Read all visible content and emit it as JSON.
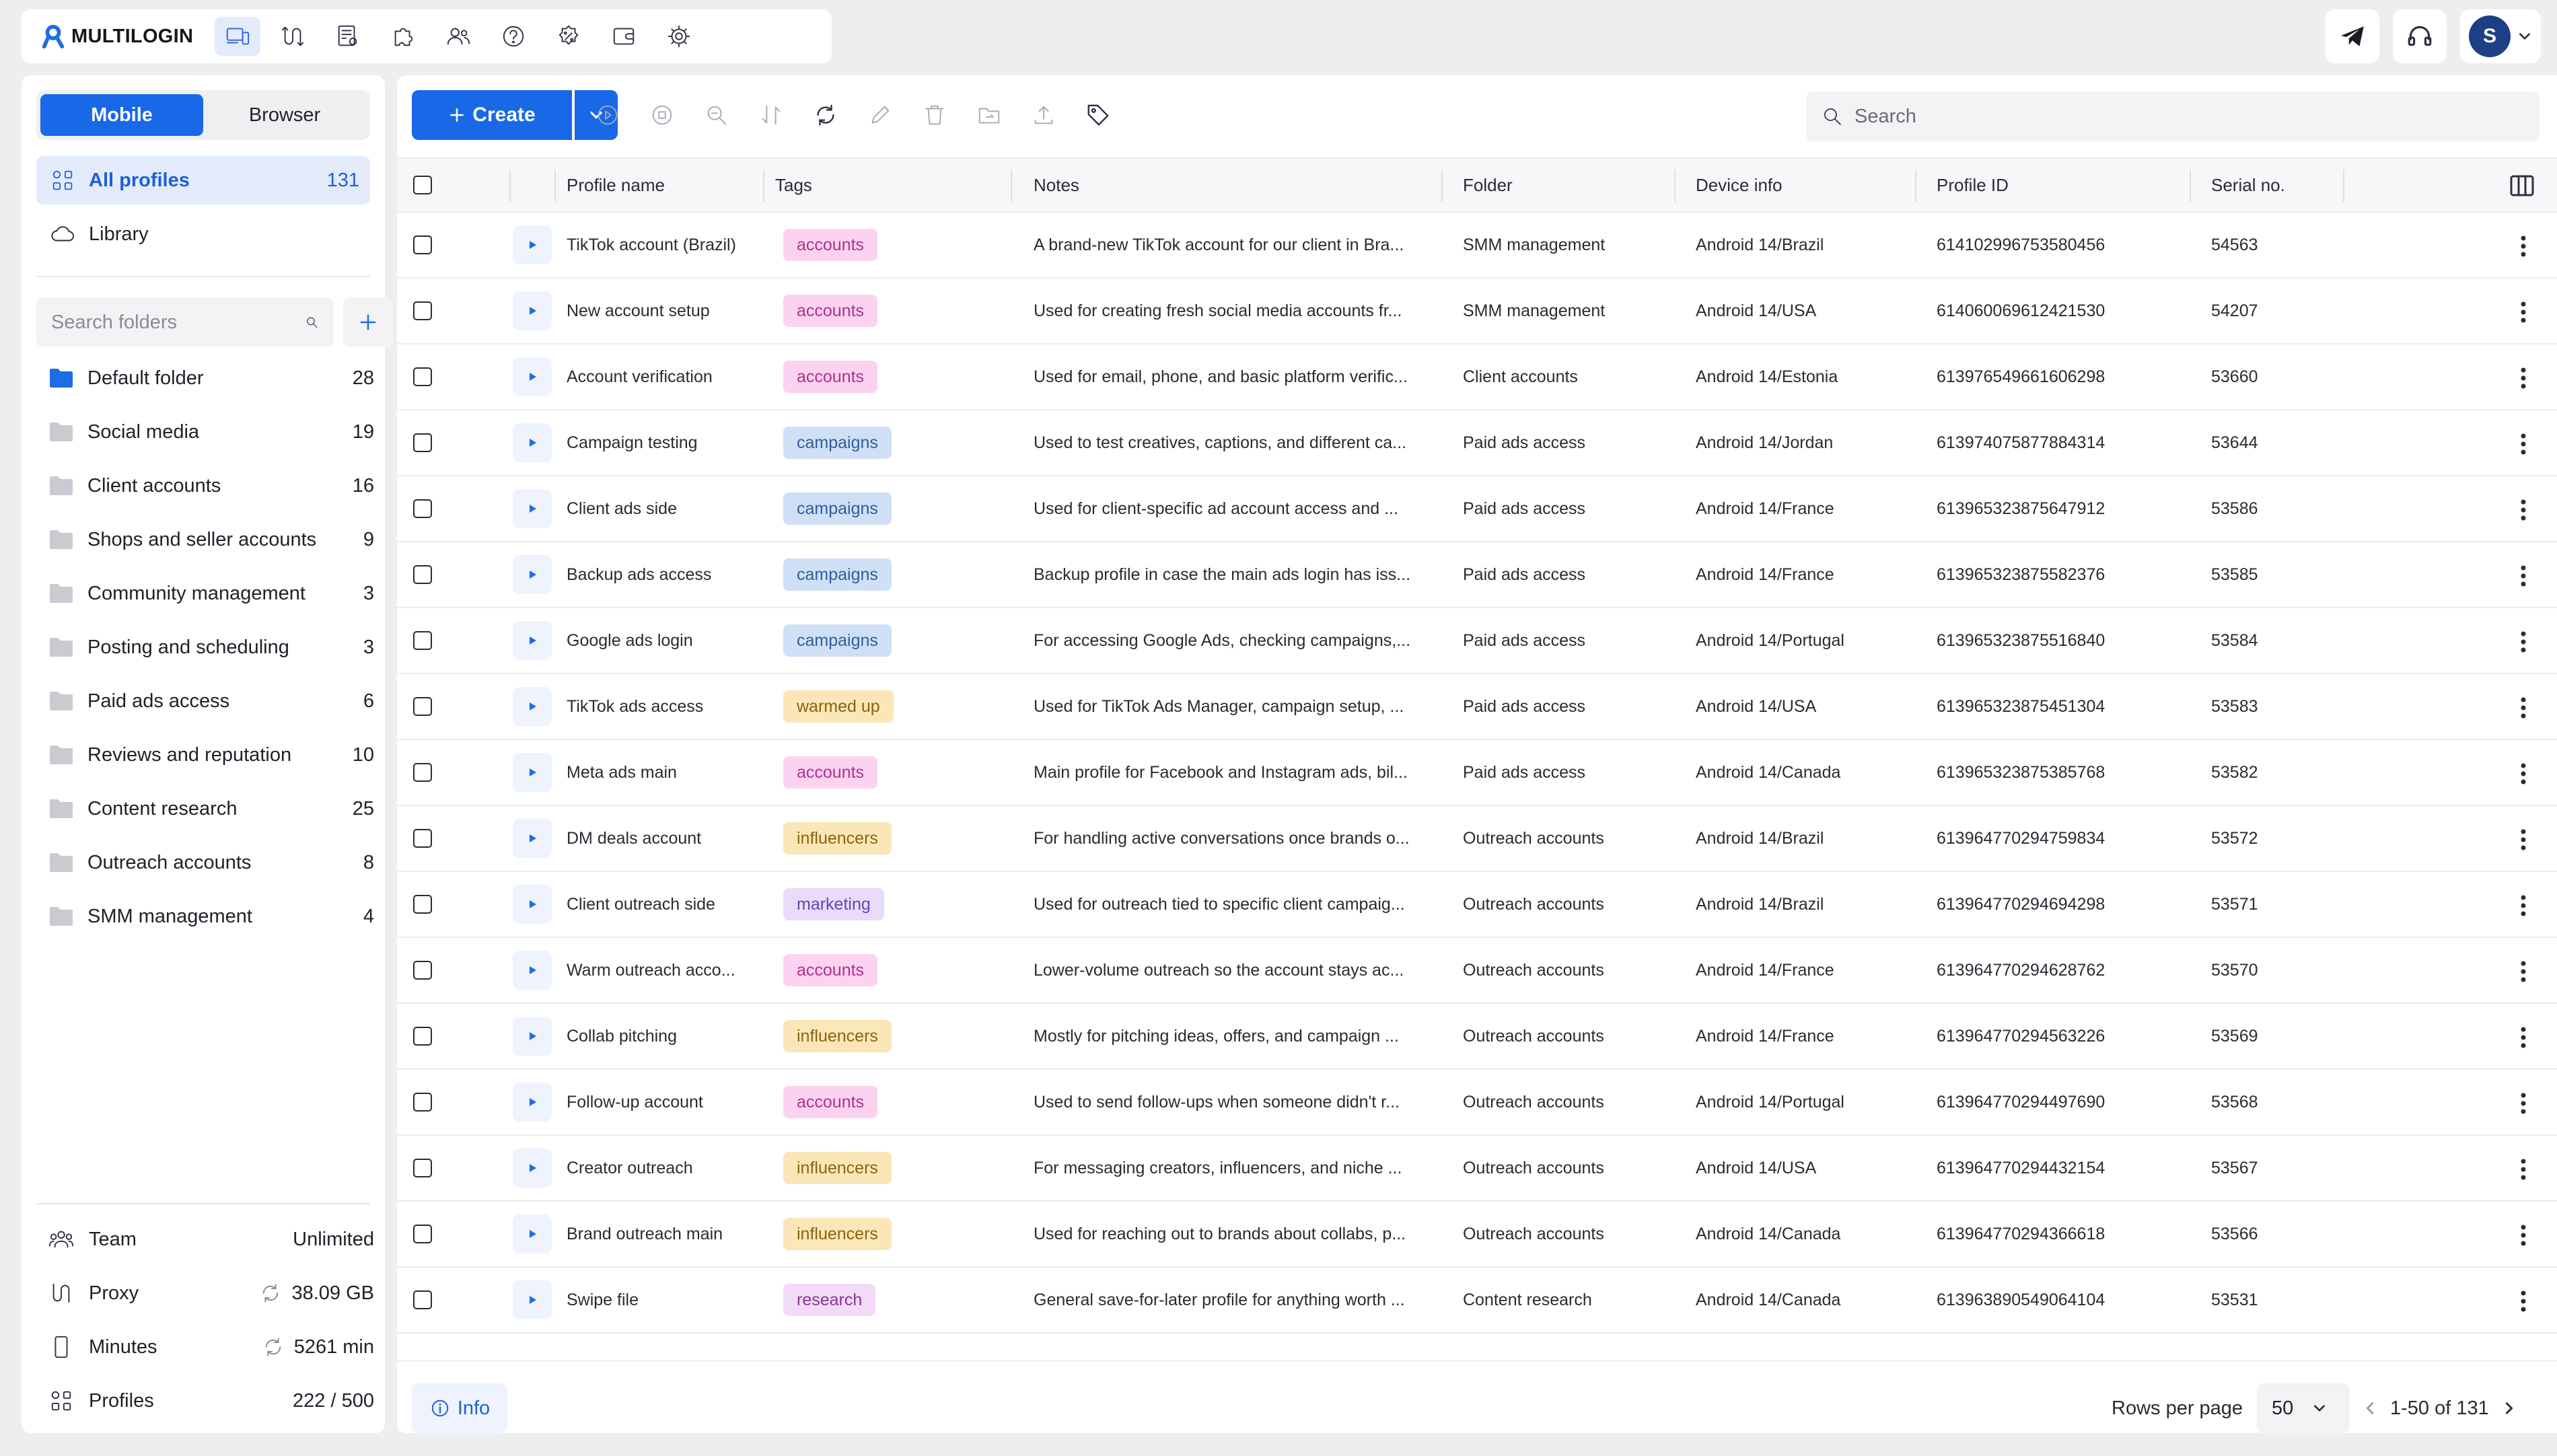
{
  "app": {
    "brand": "MULTILOGIN",
    "avatar_initial": "S"
  },
  "sidebar": {
    "tabs": [
      "Mobile",
      "Browser"
    ],
    "active_tab": "Mobile",
    "all_profiles": {
      "label": "All profiles",
      "count": "131"
    },
    "library": {
      "label": "Library"
    },
    "folder_search_placeholder": "Search folders",
    "folders": [
      {
        "name": "Default folder",
        "count": "28",
        "active": true
      },
      {
        "name": "Social media",
        "count": "19"
      },
      {
        "name": "Client accounts",
        "count": "16"
      },
      {
        "name": "Shops and seller accounts",
        "count": "9"
      },
      {
        "name": "Community management",
        "count": "3"
      },
      {
        "name": "Posting and scheduling",
        "count": "3"
      },
      {
        "name": "Paid ads access",
        "count": "6"
      },
      {
        "name": "Reviews and reputation",
        "count": "10"
      },
      {
        "name": "Content research",
        "count": "25"
      },
      {
        "name": "Outreach accounts",
        "count": "8"
      },
      {
        "name": "SMM management",
        "count": "4"
      }
    ],
    "stats": {
      "team": {
        "label": "Team",
        "value": "Unlimited"
      },
      "proxy": {
        "label": "Proxy",
        "value": "38.09 GB"
      },
      "minutes": {
        "label": "Minutes",
        "value": "5261 min"
      },
      "profiles": {
        "label": "Profiles",
        "value": "222 / 500"
      }
    }
  },
  "toolbar": {
    "create_label": "Create",
    "search_placeholder": "Search"
  },
  "table": {
    "columns": {
      "name": "Profile name",
      "tags": "Tags",
      "notes": "Notes",
      "folder": "Folder",
      "device": "Device info",
      "id": "Profile ID",
      "serial": "Serial no."
    },
    "rows": [
      {
        "name": "TikTok account (Brazil)",
        "tag": "accounts",
        "notes": "A brand-new TikTok account for our client in Bra...",
        "folder": "SMM management",
        "device": "Android 14/Brazil",
        "id": "614102996753580456",
        "serial": "54563"
      },
      {
        "name": "New account setup",
        "tag": "accounts",
        "notes": "Used for creating fresh social media accounts fr...",
        "folder": "SMM management",
        "device": "Android 14/USA",
        "id": "614060069612421530",
        "serial": "54207"
      },
      {
        "name": "Account verification",
        "tag": "accounts",
        "notes": "Used for email, phone, and basic platform verific...",
        "folder": "Client accounts",
        "device": "Android 14/Estonia",
        "id": "613976549661606298",
        "serial": "53660"
      },
      {
        "name": "Campaign testing",
        "tag": "campaigns",
        "notes": "Used to test creatives, captions, and different ca...",
        "folder": "Paid ads access",
        "device": "Android 14/Jordan",
        "id": "613974075877884314",
        "serial": "53644"
      },
      {
        "name": "Client ads side",
        "tag": "campaigns",
        "notes": "Used for client-specific ad account access and ...",
        "folder": "Paid ads access",
        "device": "Android 14/France",
        "id": "613965323875647912",
        "serial": "53586"
      },
      {
        "name": "Backup ads access",
        "tag": "campaigns",
        "notes": "Backup profile in case the main ads login has iss...",
        "folder": "Paid ads access",
        "device": "Android 14/France",
        "id": "613965323875582376",
        "serial": "53585"
      },
      {
        "name": "Google ads login",
        "tag": "campaigns",
        "notes": "For accessing Google Ads, checking campaigns,...",
        "folder": "Paid ads access",
        "device": "Android 14/Portugal",
        "id": "613965323875516840",
        "serial": "53584"
      },
      {
        "name": "TikTok ads access",
        "tag": "warmed up",
        "notes": "Used for TikTok Ads Manager, campaign setup, ...",
        "folder": "Paid ads access",
        "device": "Android 14/USA",
        "id": "613965323875451304",
        "serial": "53583"
      },
      {
        "name": "Meta ads main",
        "tag": "accounts",
        "notes": "Main profile for Facebook and Instagram ads, bil...",
        "folder": "Paid ads access",
        "device": "Android 14/Canada",
        "id": "613965323875385768",
        "serial": "53582"
      },
      {
        "name": "DM deals account",
        "tag": "influencers",
        "notes": "For handling active conversations once brands o...",
        "folder": "Outreach accounts",
        "device": "Android 14/Brazil",
        "id": "613964770294759834",
        "serial": "53572"
      },
      {
        "name": "Client outreach side",
        "tag": "marketing",
        "notes": "Used for outreach tied to specific client campaig...",
        "folder": "Outreach accounts",
        "device": "Android 14/Brazil",
        "id": "613964770294694298",
        "serial": "53571"
      },
      {
        "name": "Warm outreach acco...",
        "tag": "accounts",
        "notes": "Lower-volume outreach so the account stays ac...",
        "folder": "Outreach accounts",
        "device": "Android 14/France",
        "id": "613964770294628762",
        "serial": "53570"
      },
      {
        "name": "Collab pitching",
        "tag": "influencers",
        "notes": "Mostly for pitching ideas, offers, and campaign ...",
        "folder": "Outreach accounts",
        "device": "Android 14/France",
        "id": "613964770294563226",
        "serial": "53569"
      },
      {
        "name": "Follow-up account",
        "tag": "accounts",
        "notes": "Used to send follow-ups when someone didn't r...",
        "folder": "Outreach accounts",
        "device": "Android 14/Portugal",
        "id": "613964770294497690",
        "serial": "53568"
      },
      {
        "name": "Creator outreach",
        "tag": "influencers",
        "notes": "For messaging creators, influencers, and niche ...",
        "folder": "Outreach accounts",
        "device": "Android 14/USA",
        "id": "613964770294432154",
        "serial": "53567"
      },
      {
        "name": "Brand outreach main",
        "tag": "influencers",
        "notes": "Used for reaching out to brands about collabs, p...",
        "folder": "Outreach accounts",
        "device": "Android 14/Canada",
        "id": "613964770294366618",
        "serial": "53566"
      },
      {
        "name": "Swipe file",
        "tag": "research",
        "notes": "General save-for-later profile for anything worth ...",
        "folder": "Content research",
        "device": "Android 14/Canada",
        "id": "613963890549064104",
        "serial": "53531"
      }
    ],
    "tag_colors": {
      "accounts": {
        "bg": "#fbd3f0",
        "fg": "#b0308f"
      },
      "campaigns": {
        "bg": "#cfe0f6",
        "fg": "#2f5e9c"
      },
      "warmed up": {
        "bg": "#fae6b6",
        "fg": "#8a6410"
      },
      "influencers": {
        "bg": "#fae6b6",
        "fg": "#8a6410"
      },
      "marketing": {
        "bg": "#e7dcfa",
        "fg": "#6c41b6"
      },
      "research": {
        "bg": "#f1dbf6",
        "fg": "#8b359a"
      }
    }
  },
  "footer": {
    "info_label": "Info",
    "rows_per_page_label": "Rows per page",
    "rows_per_page_value": "50",
    "range_text": "1-50 of 131"
  },
  "colors": {
    "accent": "#1868e8",
    "accent_soft": "#e3ebfb",
    "folder_active": "#1e6ce6",
    "folder_inactive": "#c9cbd1"
  }
}
